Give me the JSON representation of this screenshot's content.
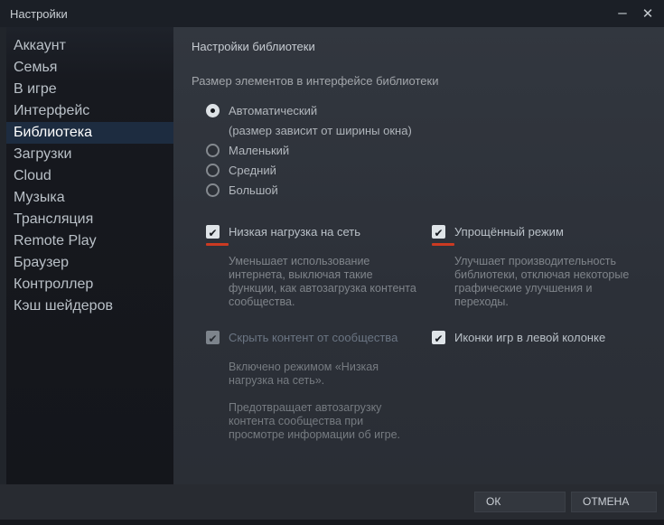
{
  "window": {
    "title": "Настройки"
  },
  "icons": {
    "minimize": "–",
    "close": "✕",
    "check": "✔"
  },
  "sidebar": {
    "items": [
      {
        "label": "Аккаунт",
        "selected": false
      },
      {
        "label": "Семья",
        "selected": false
      },
      {
        "label": "В игре",
        "selected": false
      },
      {
        "label": "Интерфейс",
        "selected": false
      },
      {
        "label": "Библиотека",
        "selected": true
      },
      {
        "label": "Загрузки",
        "selected": false
      },
      {
        "label": "Cloud",
        "selected": false
      },
      {
        "label": "Музыка",
        "selected": false
      },
      {
        "label": "Трансляция",
        "selected": false
      },
      {
        "label": "Remote Play",
        "selected": false
      },
      {
        "label": "Браузер",
        "selected": false
      },
      {
        "label": "Контроллер",
        "selected": false
      },
      {
        "label": "Кэш шейдеров",
        "selected": false
      }
    ]
  },
  "content": {
    "header": "Настройки библиотеки",
    "size": {
      "label": "Размер элементов в интерфейсе библиотеки",
      "options": [
        {
          "label": "Автоматический",
          "sublabel": "(размер зависит от ширины окна)",
          "selected": true
        },
        {
          "label": "Маленький",
          "selected": false
        },
        {
          "label": "Средний",
          "selected": false
        },
        {
          "label": "Большой",
          "selected": false
        }
      ]
    },
    "checkboxes": [
      {
        "label": "Низкая нагрузка на сеть",
        "checked": true,
        "disabled": false,
        "red_underline": true,
        "description": "Уменьшает использование интернета, выключая такие функции, как автозагрузка контента сообщества."
      },
      {
        "label": "Упрощённый режим",
        "checked": true,
        "disabled": false,
        "red_underline": true,
        "description": "Улучшает производительность библиотеки, отключая некоторые графические улучшения и переходы."
      },
      {
        "label": "Скрыть контент от сообщества",
        "checked": true,
        "disabled": true,
        "red_underline": false,
        "description": "Включено режимом «Низкая нагрузка на сеть».",
        "description2": "Предотвращает автозагрузку контента сообщества при просмотре информации об игре."
      },
      {
        "label": "Иконки игр в левой колонке",
        "checked": true,
        "disabled": false,
        "red_underline": false
      }
    ]
  },
  "footer": {
    "ok_label": "ОК",
    "cancel_label": "ОТМЕНА"
  },
  "colors": {
    "selected_item_bg": "#1d2c40",
    "red_underline": "#cb3a22",
    "content_bg": "#2e333b",
    "sidebar_bg": "#16181d"
  }
}
